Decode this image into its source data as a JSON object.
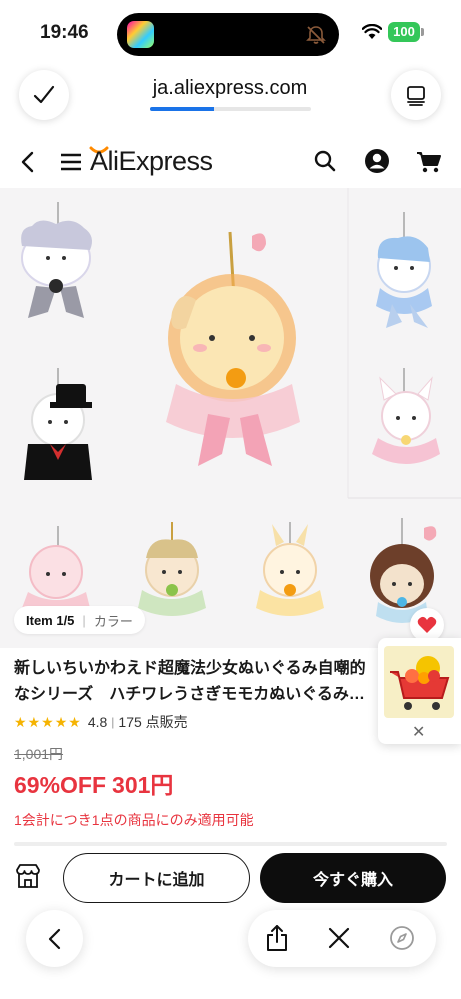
{
  "status_bar": {
    "time": "19:46",
    "battery": "100",
    "icons": [
      "app-icon",
      "mute-icon",
      "wifi-icon",
      "battery-icon"
    ]
  },
  "browser": {
    "url": "ja.aliexpress.com",
    "load_progress": 0.4,
    "done_icon": "check-icon",
    "tabs_icon": "tabs-icon"
  },
  "site_header": {
    "logo": "AliExpress",
    "icons": [
      "back-icon",
      "menu-icon",
      "search-icon",
      "account-icon",
      "cart-icon"
    ]
  },
  "gallery": {
    "item_index": "Item 1/5",
    "variant_label": "カラー",
    "favorite_icon": "heart-icon"
  },
  "floating_widget": {
    "icon": "shopping-cart-image",
    "close": "✕"
  },
  "product": {
    "title": "新しいちいかわえド超魔法少女ぬいぐるみ自嘲的なシリーズ　ハチワレうさぎモモカぬいぐるみおもちゃ女の子",
    "rating": "4.8",
    "sold": "175 点販売",
    "original_price": "1,001円",
    "discount": "69%OFF",
    "price": "301円",
    "limit_note": "1会計につき1点の商品にのみ適用可能"
  },
  "actions": {
    "store_icon": "store-icon",
    "add_to_cart": "カートに追加",
    "buy_now": "今すぐ購入"
  },
  "browser_bottom": {
    "icons": [
      "back-icon",
      "share-icon",
      "close-icon",
      "compass-icon"
    ]
  },
  "colors": {
    "accent_red": "#e8343f",
    "ali_orange": "#ff8a00",
    "progress_blue": "#1a73e8",
    "star": "#f5b301",
    "battery_green": "#34c759"
  }
}
